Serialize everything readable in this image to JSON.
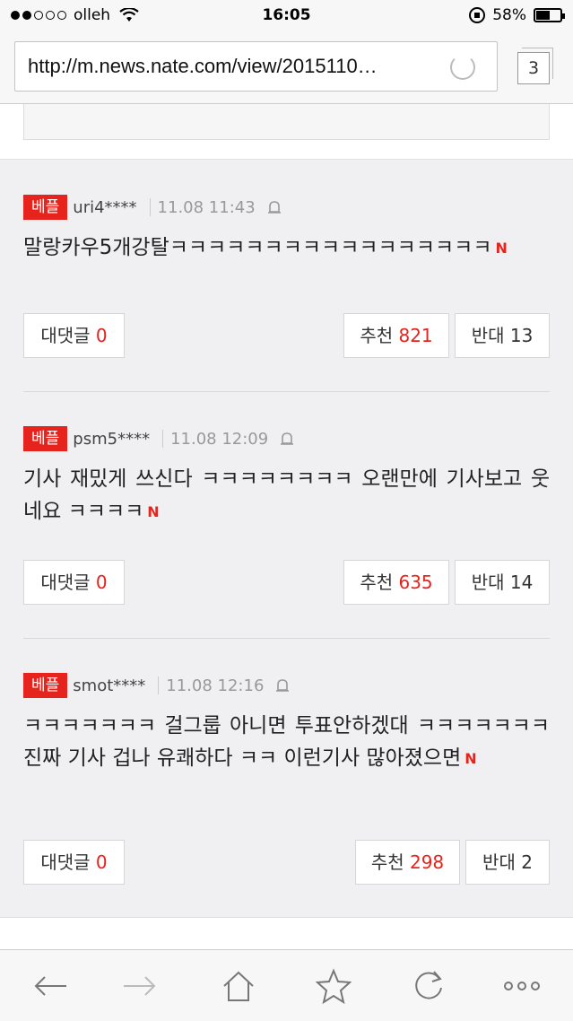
{
  "status": {
    "carrier": "olleh",
    "time": "16:05",
    "battery": "58%",
    "battery_level": 0.58
  },
  "browser": {
    "url": "http://m.news.nate.com/view/2015110…",
    "tab_count": "3"
  },
  "comments": [
    {
      "badge": "베플",
      "user": "uri4****",
      "date": "11.08 11:43",
      "text": "말랑카우5개강탈ㅋㅋㅋㅋㅋㅋㅋㅋㅋㅋㅋㅋㅋㅋㅋㅋㅋ",
      "new_mark": "N",
      "reply_label": "대댓글",
      "reply_count": "0",
      "up_label": "추천",
      "up_count": "821",
      "down_label": "반대",
      "down_count": "13"
    },
    {
      "badge": "베플",
      "user": "psm5****",
      "date": "11.08 12:09",
      "text": "기사 재밌게 쓰신다 ㅋㅋㅋㅋㅋㅋㅋㅋ 오랜만에 기사보고 웃네요 ㅋㅋㅋㅋ",
      "new_mark": "N",
      "reply_label": "대댓글",
      "reply_count": "0",
      "up_label": "추천",
      "up_count": "635",
      "down_label": "반대",
      "down_count": "14"
    },
    {
      "badge": "베플",
      "user": "smot****",
      "date": "11.08 12:16",
      "text": "ㅋㅋㅋㅋㅋㅋㅋ 걸그룹 아니면 투표안하겠대 ㅋㅋㅋㅋㅋㅋㅋ 진짜 기사 겁나 유쾌하다 ㅋㅋ 이런기사 많아졌으면",
      "new_mark": "N",
      "reply_label": "대댓글",
      "reply_count": "0",
      "up_label": "추천",
      "up_count": "298",
      "down_label": "반대",
      "down_count": "2"
    }
  ],
  "toolbar": {
    "icons": [
      "back-arrow-icon",
      "forward-arrow-icon",
      "home-icon",
      "star-icon",
      "refresh-icon",
      "more-icon"
    ]
  }
}
